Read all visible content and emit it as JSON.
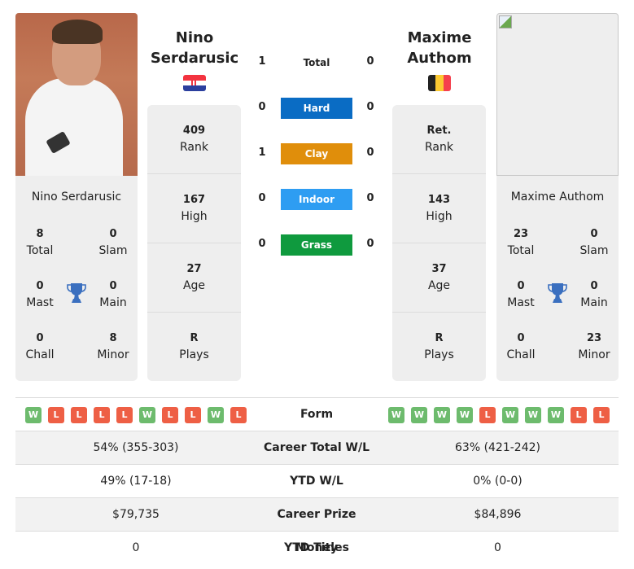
{
  "colors": {
    "hard": "#0a6cc4",
    "clay": "#e08e0b",
    "indoor": "#2e9df2",
    "grass": "#0f9a3e",
    "win": "#6dbb6d",
    "loss": "#ee5f45",
    "trophy": "#3a6fbf"
  },
  "player1": {
    "name_line1": "Nino",
    "name_line2": "Serdarusic",
    "full_name": "Nino Serdarusic",
    "country": "Croatia",
    "flag_icon": "croatia-flag-icon",
    "rank": "409",
    "rank_label": "Rank",
    "high": "167",
    "high_label": "High",
    "age": "27",
    "age_label": "Age",
    "plays": "R",
    "plays_label": "Plays",
    "titles": {
      "total": "8",
      "total_label": "Total",
      "slam": "0",
      "slam_label": "Slam",
      "mast": "0",
      "mast_label": "Mast",
      "main": "0",
      "main_label": "Main",
      "chall": "0",
      "chall_label": "Chall",
      "minor": "8",
      "minor_label": "Minor"
    },
    "form": [
      "W",
      "L",
      "L",
      "L",
      "L",
      "W",
      "L",
      "L",
      "W",
      "L"
    ],
    "career_wl": "54% (355-303)",
    "ytd_wl": "49% (17-18)",
    "prize_money": "$79,735",
    "ytd_titles": "0"
  },
  "player2": {
    "name_line1": "Maxime",
    "name_line2": "Authom",
    "full_name": "Maxime Authom",
    "country": "Belgium",
    "flag_icon": "belgium-flag-icon",
    "rank": "Ret.",
    "rank_label": "Rank",
    "high": "143",
    "high_label": "High",
    "age": "37",
    "age_label": "Age",
    "plays": "R",
    "plays_label": "Plays",
    "titles": {
      "total": "23",
      "total_label": "Total",
      "slam": "0",
      "slam_label": "Slam",
      "mast": "0",
      "mast_label": "Mast",
      "main": "0",
      "main_label": "Main",
      "chall": "0",
      "chall_label": "Chall",
      "minor": "23",
      "minor_label": "Minor"
    },
    "form": [
      "W",
      "W",
      "W",
      "W",
      "L",
      "W",
      "W",
      "W",
      "L",
      "L"
    ],
    "career_wl": "63% (421-242)",
    "ytd_wl": "0% (0-0)",
    "prize_money": "$84,896",
    "ytd_titles": "0"
  },
  "h2h": [
    {
      "label": "Total",
      "p1": "1",
      "p2": "0",
      "surface": "total"
    },
    {
      "label": "Hard",
      "p1": "0",
      "p2": "0",
      "surface": "hard"
    },
    {
      "label": "Clay",
      "p1": "1",
      "p2": "0",
      "surface": "clay"
    },
    {
      "label": "Indoor",
      "p1": "0",
      "p2": "0",
      "surface": "indoor"
    },
    {
      "label": "Grass",
      "p1": "0",
      "p2": "0",
      "surface": "grass"
    }
  ],
  "table": {
    "form_label": "Form",
    "career_wl_label": "Career Total W/L",
    "ytd_wl_label": "YTD W/L",
    "prize_label": "Career Prize Money",
    "ytd_titles_label": "YTD Titles"
  }
}
